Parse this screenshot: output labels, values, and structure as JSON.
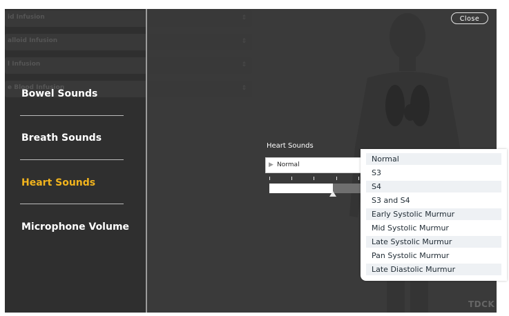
{
  "background_rows": [
    {
      "text": "id Infusion"
    },
    {
      "text": "alloid Infusion"
    },
    {
      "text": "l Infusion"
    },
    {
      "text": "e Blood Infusion"
    }
  ],
  "sidebar": {
    "items": [
      {
        "label": "Bowel Sounds",
        "active": false
      },
      {
        "label": "Breath Sounds",
        "active": false
      },
      {
        "label": "Heart Sounds",
        "active": true
      },
      {
        "label": "Microphone Volume",
        "active": false
      }
    ]
  },
  "close_button": {
    "label": "Close"
  },
  "heart_sounds": {
    "label": "Heart Sounds",
    "selected": "Normal",
    "volume_fraction": 0.7,
    "options": [
      "Normal",
      "S3",
      "S4",
      "S3 and S4",
      "Early Systolic Murmur",
      "Mid Systolic Murmur",
      "Late Systolic Murmur",
      "Pan Systolic Murmur",
      "Late Diastolic Murmur"
    ]
  },
  "watermark": "TDCK",
  "colors": {
    "active_menu": "#f2b41d",
    "panel_bg": "#2f2f2f",
    "dropdown_bg": "#ffffff"
  },
  "icons": {
    "select_arrow": "triangle-right-icon",
    "slider_thumb": "triangle-up-icon",
    "row_handle": "up-down-arrows-icon"
  }
}
